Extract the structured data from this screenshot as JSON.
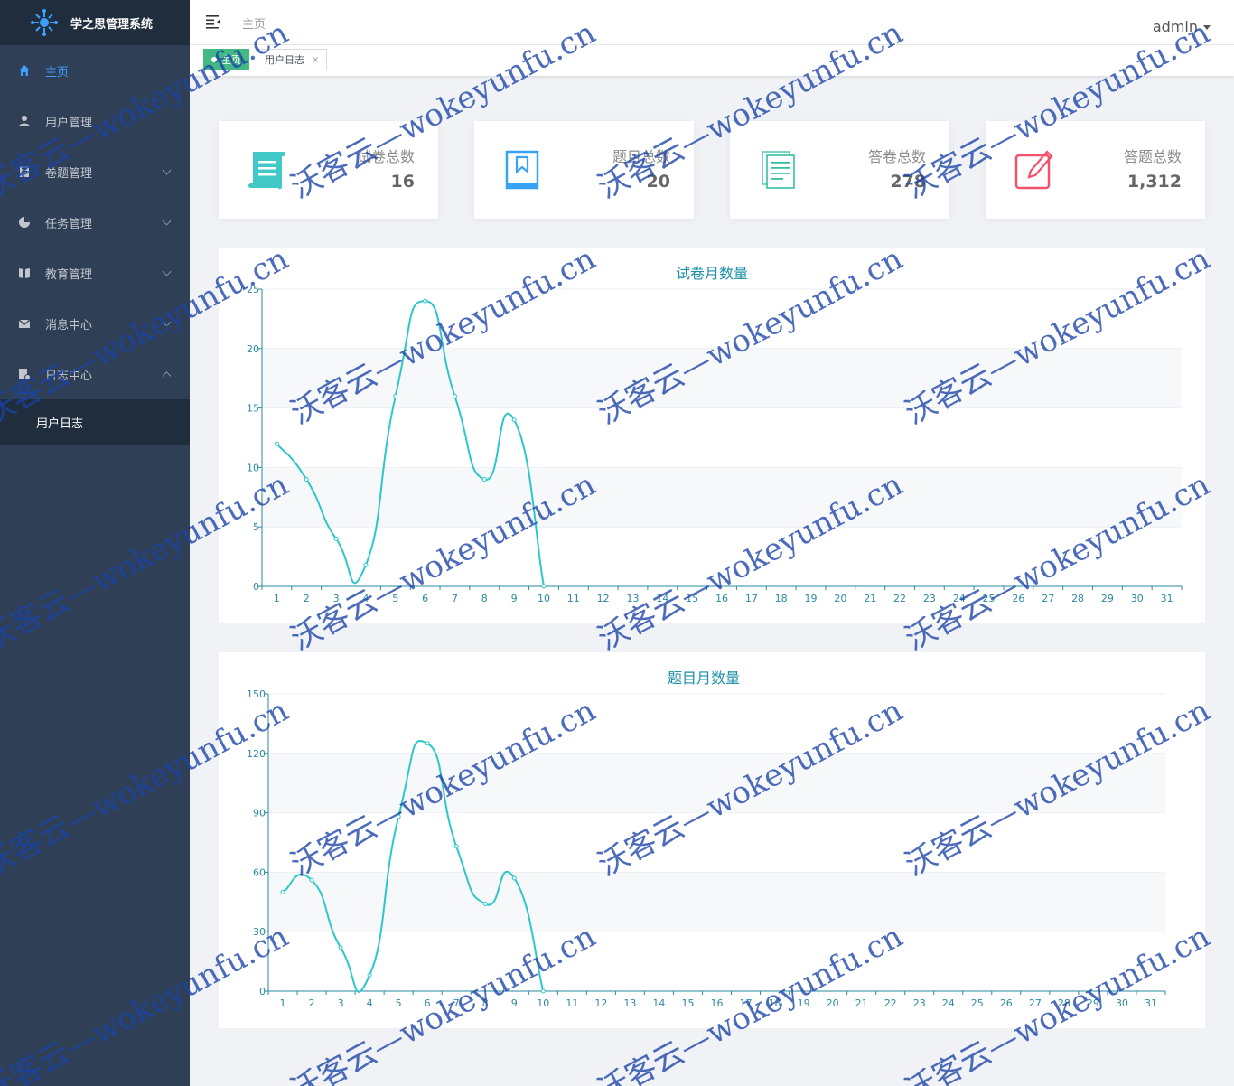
{
  "app": {
    "title": "学之思管理系统"
  },
  "sidebar": {
    "items": [
      {
        "label": "主页",
        "icon": "home-icon",
        "active": true
      },
      {
        "label": "用户管理",
        "icon": "user-icon"
      },
      {
        "label": "卷题管理",
        "icon": "book-icon",
        "expandable": true
      },
      {
        "label": "任务管理",
        "icon": "task-icon",
        "expandable": true
      },
      {
        "label": "教育管理",
        "icon": "education-icon",
        "expandable": true
      },
      {
        "label": "消息中心",
        "icon": "mail-icon",
        "expandable": true
      },
      {
        "label": "日志中心",
        "icon": "log-icon",
        "expandable": true,
        "expanded": true
      }
    ],
    "subitem": {
      "label": "用户日志"
    }
  },
  "header": {
    "home": "主页",
    "user": "admin"
  },
  "tags": {
    "home": "主页",
    "log": "用户日志",
    "close": "×"
  },
  "cards": [
    {
      "label": "试卷总数",
      "value": "16",
      "icon": "scroll-icon",
      "color": "#40c9c6"
    },
    {
      "label": "题目总数",
      "value": "20",
      "icon": "question-book-icon",
      "color": "#36a3f7"
    },
    {
      "label": "答卷总数",
      "value": "278",
      "icon": "answer-sheet-icon",
      "color": "#34bfa3"
    },
    {
      "label": "答题总数",
      "value": "1,312",
      "icon": "edit-icon",
      "color": "#f4516c"
    }
  ],
  "watermark": {
    "text": "沃客云—wokeyunfu.cn"
  },
  "chart_data": [
    {
      "type": "line",
      "title": "试卷月数量",
      "categories": [
        "1",
        "2",
        "3",
        "4",
        "5",
        "6",
        "7",
        "8",
        "9",
        "10",
        "11",
        "12",
        "13",
        "14",
        "15",
        "16",
        "17",
        "18",
        "19",
        "20",
        "21",
        "22",
        "23",
        "24",
        "25",
        "26",
        "27",
        "28",
        "29",
        "30",
        "31"
      ],
      "values": [
        12,
        9,
        4,
        1.8,
        16,
        24,
        16,
        9,
        14,
        0
      ],
      "ylim": [
        0,
        25
      ],
      "yticks": [
        0,
        5,
        10,
        15,
        20,
        25
      ],
      "color": "#2ec7c9"
    },
    {
      "type": "line",
      "title": "题目月数量",
      "categories": [
        "1",
        "2",
        "3",
        "4",
        "5",
        "6",
        "7",
        "8",
        "9",
        "10",
        "11",
        "12",
        "13",
        "14",
        "15",
        "16",
        "17",
        "18",
        "19",
        "20",
        "21",
        "22",
        "23",
        "24",
        "25",
        "26",
        "27",
        "28",
        "29",
        "30",
        "31"
      ],
      "values": [
        50,
        56,
        22,
        8,
        88,
        125,
        73,
        44,
        57,
        0
      ],
      "ylim": [
        0,
        150
      ],
      "yticks": [
        0,
        30,
        60,
        90,
        120,
        150
      ],
      "color": "#2ec7c9"
    }
  ]
}
